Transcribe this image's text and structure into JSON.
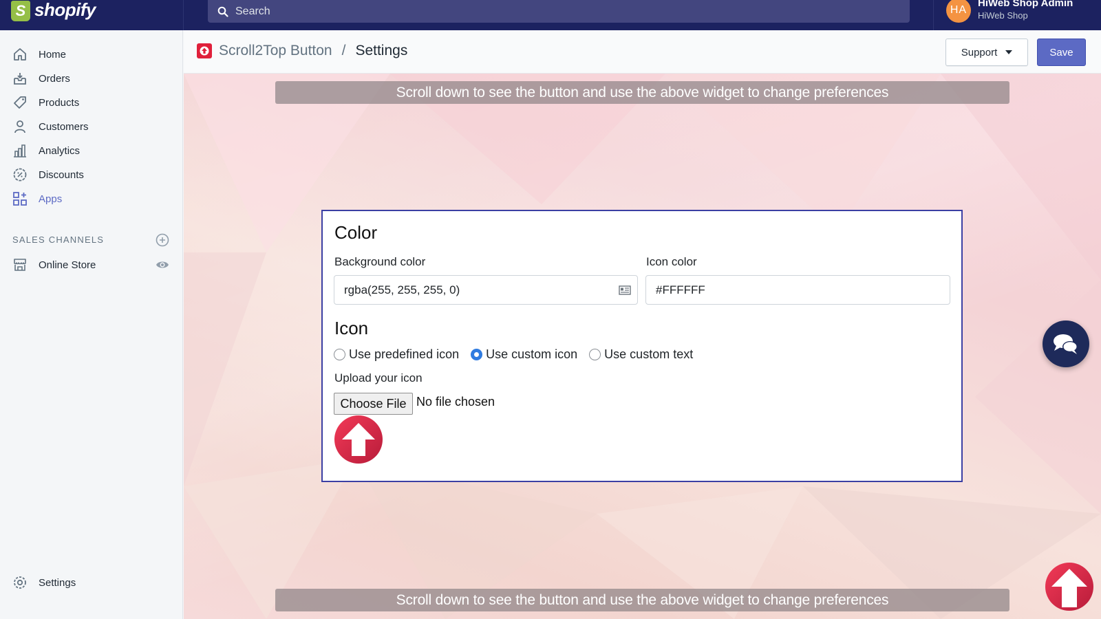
{
  "brand": {
    "name": "shopify",
    "logo_letter": "S"
  },
  "search": {
    "placeholder": "Search"
  },
  "user": {
    "initials": "HA",
    "name": "HiWeb Shop Admin",
    "shop": "HiWeb Shop"
  },
  "sidebar": {
    "items": [
      {
        "label": "Home",
        "icon": "home-icon"
      },
      {
        "label": "Orders",
        "icon": "orders-icon"
      },
      {
        "label": "Products",
        "icon": "tag-icon"
      },
      {
        "label": "Customers",
        "icon": "person-icon"
      },
      {
        "label": "Analytics",
        "icon": "bar-chart-icon"
      },
      {
        "label": "Discounts",
        "icon": "discount-icon"
      },
      {
        "label": "Apps",
        "icon": "apps-icon",
        "active": true
      }
    ],
    "sales_channels_title": "SALES CHANNELS",
    "online_store": "Online Store",
    "settings": "Settings"
  },
  "header": {
    "app_name": "Scroll2Top Button",
    "separator": "/",
    "current": "Settings",
    "support_label": "Support",
    "save_label": "Save"
  },
  "banner": {
    "text": "Scroll down to see the button and use the above widget to change preferences"
  },
  "panel": {
    "color_heading": "Color",
    "background_color_label": "Background color",
    "background_color_value": "rgba(255, 255, 255, 0)",
    "icon_color_label": "Icon color",
    "icon_color_value": "#FFFFFF",
    "icon_heading": "Icon",
    "radio_options": [
      "Use predefined icon",
      "Use custom icon",
      "Use custom text"
    ],
    "radio_selected": 1,
    "upload_label": "Upload your icon",
    "choose_file": "Choose File",
    "file_status": "No file chosen"
  },
  "colors": {
    "topbar": "#1c2260",
    "accent": "#5c6ac4",
    "brand_green": "#95bf47",
    "avatar": "#f49342",
    "scroll_icon": "#e0203b"
  }
}
